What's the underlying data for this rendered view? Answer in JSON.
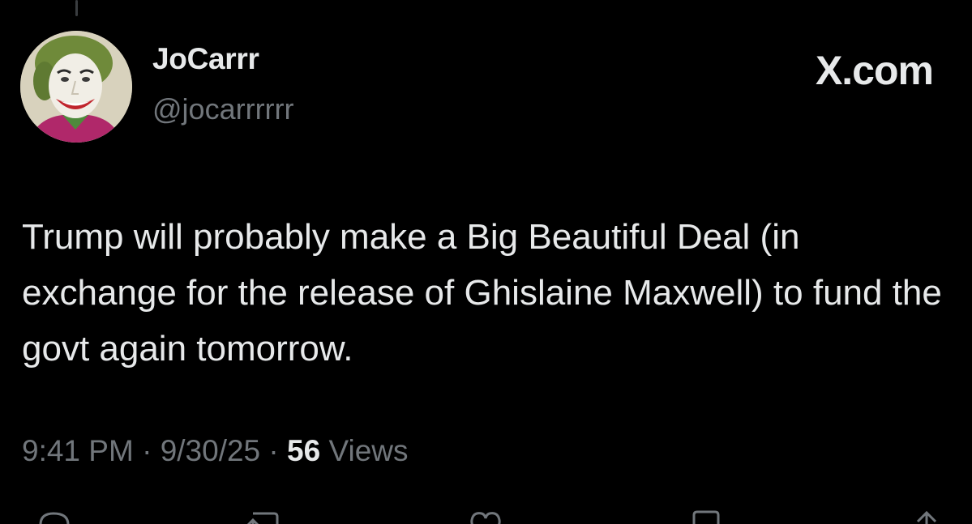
{
  "author": {
    "display_name": "JoCarrr",
    "handle": "@jocarrrrrr",
    "avatar": "joker-portrait-avatar"
  },
  "brand": "X.com",
  "tweet": {
    "text": "Trump will probably make a Big Beautiful Deal (in exchange for the release of Ghislaine Maxwell) to fund the govt again tomorrow.",
    "time": "9:41 PM",
    "date": "9/30/25",
    "separator": "·",
    "views_count": "56",
    "views_label": "Views"
  },
  "actions": [
    {
      "name": "reply-icon"
    },
    {
      "name": "repost-icon"
    },
    {
      "name": "like-icon"
    },
    {
      "name": "bookmark-icon"
    },
    {
      "name": "share-icon"
    }
  ],
  "colors": {
    "background": "#000000",
    "primary_text": "#e7e9ea",
    "secondary_text": "#71767b"
  }
}
